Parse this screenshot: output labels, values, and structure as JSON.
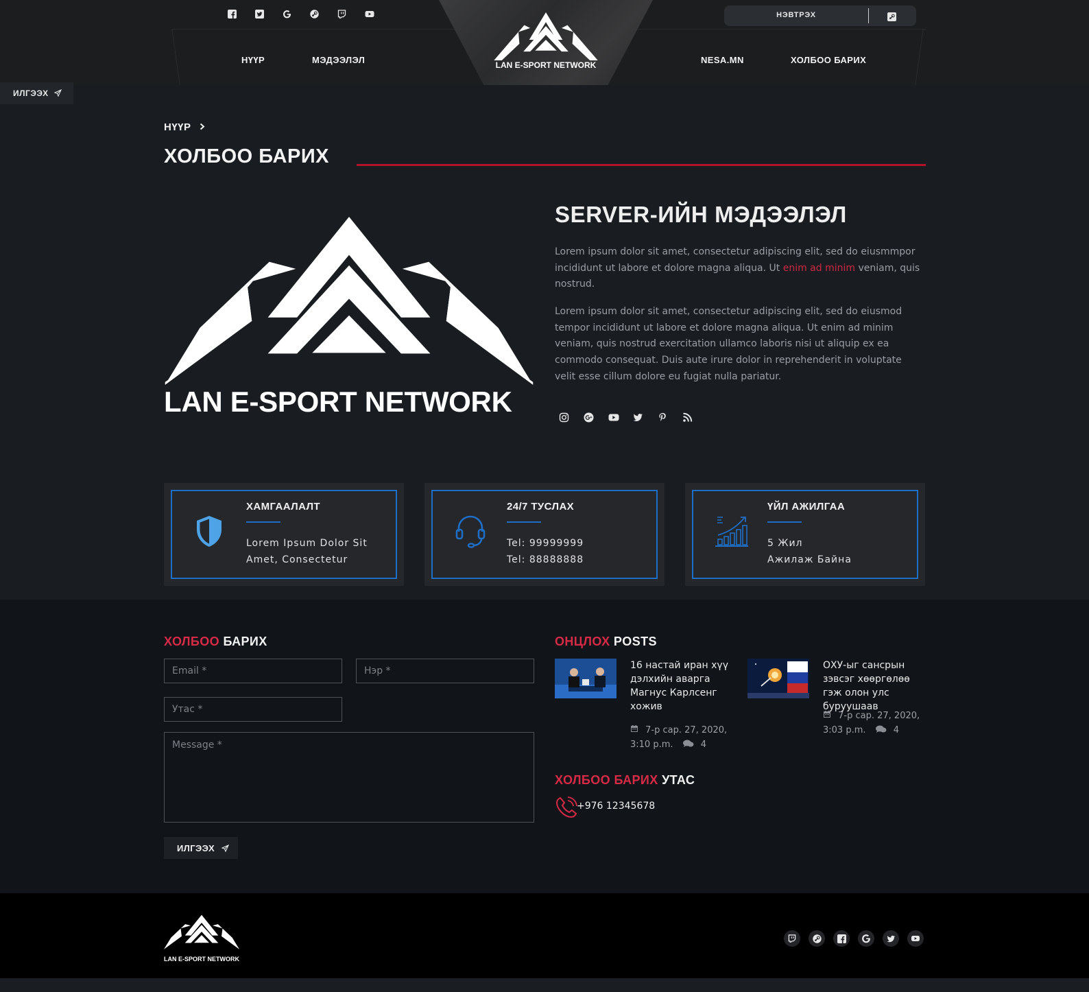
{
  "header": {
    "social_icons": [
      "facebook-icon",
      "twitter-icon",
      "google-icon",
      "steam-icon",
      "twitch-icon",
      "youtube-icon"
    ],
    "nav_left": [
      "НҮҮР",
      "МЭДЭЭЛЭЛ"
    ],
    "nav_right": [
      "NESA.MN",
      "ХОЛБОО БАРИХ"
    ],
    "logo_text": "LAN E-SPORT NETWORK",
    "login_label": "НЭВТРЭХ",
    "side_send_label": "ИЛГЭЭХ"
  },
  "page": {
    "breadcrumb": "НҮҮР",
    "title": "ХОЛБОО БАРИХ",
    "logo_text": "LAN E-SPORT NETWORK"
  },
  "server": {
    "title": "SERVER-ИЙН МЭДЭЭЛЭЛ",
    "para1_before": "Lorem ipsum dolor sit amet, consectetur adipiscing elit, sed do eiusmmpor incididunt ut labore et dolore magna aliqua. Ut ",
    "para1_link": "enim ad minim",
    "para1_after": " veniam, quis nostrud.",
    "para2": "Lorem ipsum dolor sit amet, consectetur adipiscing elit, sed do eiusmod tempor incididunt ut labore et dolore magna aliqua. Ut enim ad minim veniam, quis nostrud exercitation ullamco laboris nisi ut aliquip ex ea commodo consequat. Duis aute irure dolor in reprehenderit in voluptate velit esse cillum dolore eu fugiat nulla pariatur.",
    "social_icons": [
      "instagram-icon",
      "google-plus-icon",
      "youtube-icon",
      "twitter-icon",
      "pinterest-icon",
      "rss-icon"
    ]
  },
  "features": [
    {
      "title": "ХАМГААЛАЛТ",
      "line1": "Lorem Ipsum Dolor Sit",
      "line2": "Amet, Consectetur",
      "icon": "shield-icon"
    },
    {
      "title": "24/7 ТУСЛАХ",
      "line1": "Tel: 99999999",
      "line2": "Tel: 88888888",
      "icon": "headset-icon"
    },
    {
      "title": "ҮЙЛ АЖИЛГАА",
      "line1": "5 Жил",
      "line2": "Ажилаж Байна",
      "icon": "growth-chart-icon"
    }
  ],
  "contact_form": {
    "title_red": "ХОЛБОО",
    "title_white": " БАРИХ",
    "email_placeholder": "Email *",
    "name_placeholder": "Нэр *",
    "phone_placeholder": "Утас *",
    "message_placeholder": "Message *",
    "send_label": "ИЛГЭЭХ"
  },
  "posts": {
    "title_red": "ОНЦЛОХ",
    "title_white": " POSTS",
    "items": [
      {
        "title": "16 настай иран хүү дэлхийн аварга Магнус Карлсенг хожив",
        "date": "7-р сар. 27, 2020,",
        "time": "3:10 p.m.",
        "comments": "4"
      },
      {
        "title": "ОХУ-ыг сансрын зэвсэг хөөргөлөө гэж олон улс буруушаав",
        "date": "7-р сар. 27, 2020,",
        "time": "3:03 p.m.",
        "comments": "4"
      }
    ]
  },
  "contact_phone": {
    "title_red": "ХОЛБОО БАРИХ",
    "title_white": " УТАС",
    "number": "+976 12345678"
  },
  "footer": {
    "logo_text": "LAN E-SPORT NETWORK",
    "social_icons": [
      "twitch-icon",
      "steam-icon",
      "facebook-icon",
      "google-icon",
      "twitter-icon",
      "youtube-icon"
    ]
  },
  "colors": {
    "accent_red": "#d62a47",
    "accent_blue": "#1f6ec6",
    "background": "#191d22"
  }
}
